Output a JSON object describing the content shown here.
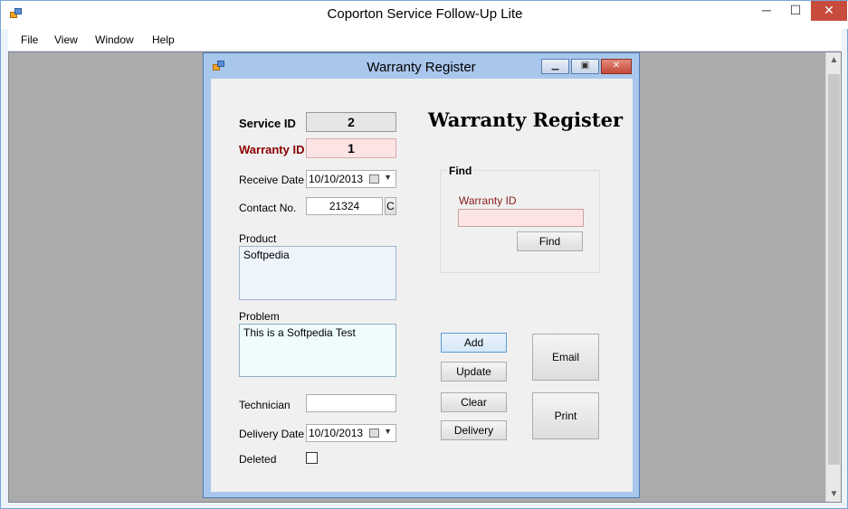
{
  "app": {
    "title": "Coporton Service Follow-Up Lite",
    "controls": {
      "minimize": "─",
      "maximize": "☐",
      "close": "✕"
    }
  },
  "menu": {
    "file": "File",
    "view": "View",
    "window": "Window",
    "help": "Help"
  },
  "scrollbar": {
    "up": "▲",
    "down": "▼"
  },
  "child": {
    "title": "Warranty Register",
    "controls": {
      "minimize": "▁",
      "maximize": "▣",
      "close": "✕"
    }
  },
  "form": {
    "heading": "Warranty Register",
    "service_id_label": "Service ID",
    "service_id_value": "2",
    "warranty_id_label": "Warranty ID",
    "warranty_id_value": "1",
    "receive_date_label": "Receive Date",
    "receive_date_value": "10/10/2013",
    "contact_no_label": "Contact No.",
    "contact_no_value": "21324",
    "contact_c_button": "C",
    "product_label": "Product",
    "product_value": "Softpedia",
    "problem_label": "Problem",
    "problem_value": "This is a Softpedia Test",
    "technician_label": "Technician",
    "technician_value": "",
    "delivery_date_label": "Delivery Date",
    "delivery_date_value": "10/10/2013",
    "deleted_label": "Deleted",
    "deleted_checked": false
  },
  "find": {
    "group_title": "Find",
    "warranty_id_label": "Warranty ID",
    "warranty_id_value": "",
    "find_button": "Find"
  },
  "buttons": {
    "add": "Add",
    "update": "Update",
    "clear": "Clear",
    "delivery": "Delivery",
    "email": "Email",
    "print": "Print"
  },
  "colors": {
    "warranty_label": "#8b0000",
    "pink_field": "#fde4e4",
    "product_bg": "#eef4fb",
    "problem_bg": "#eefcfd",
    "mdi_background": "#ababab"
  }
}
